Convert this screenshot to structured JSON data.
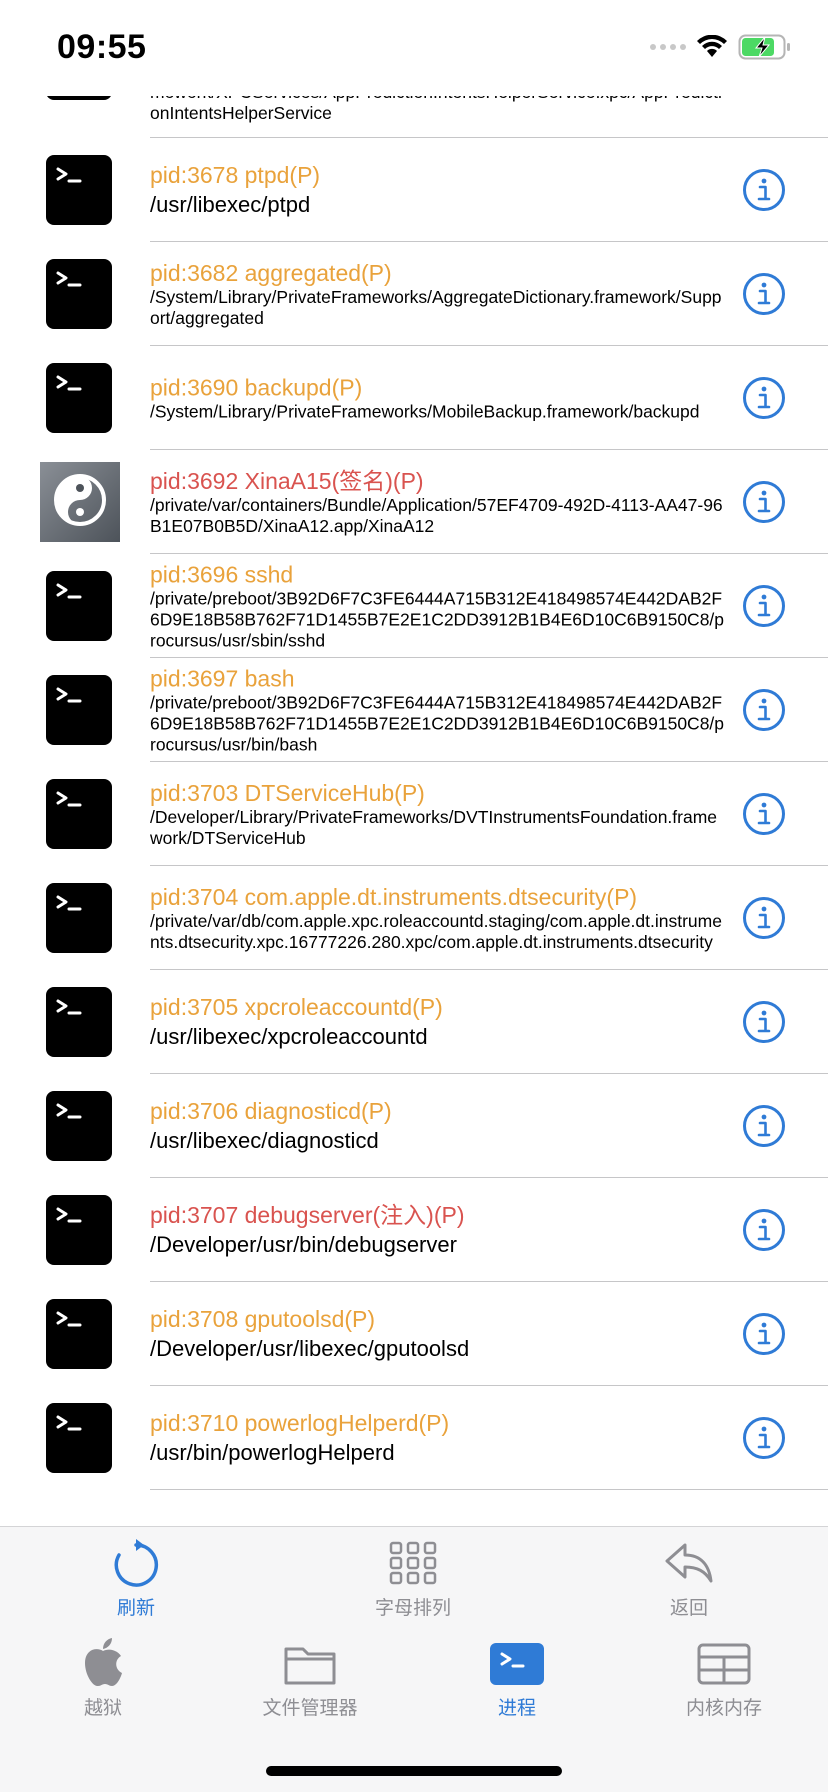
{
  "status_bar": {
    "time": "09:55"
  },
  "colors": {
    "orange": "#e9a23b",
    "red": "#d9534f",
    "blue": "#2f7bd6",
    "gray": "#8e8e93"
  },
  "partial_row": {
    "path": "mework/XPCServices/AppPredictionIntentsHelperService.xpc/AppPredictionIntentsHelperService"
  },
  "processes": [
    {
      "title": "pid:3678 ptpd(P)",
      "path": "/usr/libexec/ptpd",
      "style": "orange",
      "icon": "terminal-icon"
    },
    {
      "title": "pid:3682 aggregated(P)",
      "path": "/System/Library/PrivateFrameworks/AggregateDictionary.framework/Support/aggregated",
      "style": "orange",
      "icon": "terminal-icon"
    },
    {
      "title": "pid:3690 backupd(P)",
      "path": "/System/Library/PrivateFrameworks/MobileBackup.framework/backupd",
      "style": "orange",
      "icon": "terminal-icon"
    },
    {
      "title": "pid:3692 XinaA15(签名)(P)",
      "path": "/private/var/containers/Bundle/Application/57EF4709-492D-4113-AA47-96B1E07B0B5D/XinaA12.app/XinaA12",
      "style": "red",
      "icon": "xina-app-icon"
    },
    {
      "title": "pid:3696 sshd",
      "path": "/private/preboot/3B92D6F7C3FE6444A715B312E418498574E442DAB2F6D9E18B58B762F71D1455B7E2E1C2DD3912B1B4E6D10C6B9150C8/procursus/usr/sbin/sshd",
      "style": "orange",
      "icon": "terminal-icon"
    },
    {
      "title": "pid:3697 bash",
      "path": "/private/preboot/3B92D6F7C3FE6444A715B312E418498574E442DAB2F6D9E18B58B762F71D1455B7E2E1C2DD3912B1B4E6D10C6B9150C8/procursus/usr/bin/bash",
      "style": "orange",
      "icon": "terminal-icon"
    },
    {
      "title": "pid:3703 DTServiceHub(P)",
      "path": "/Developer/Library/PrivateFrameworks/DVTInstrumentsFoundation.framework/DTServiceHub",
      "style": "orange",
      "icon": "terminal-icon"
    },
    {
      "title": "pid:3704 com.apple.dt.instruments.dtsecurity(P)",
      "path": "/private/var/db/com.apple.xpc.roleaccountd.staging/com.apple.dt.instruments.dtsecurity.xpc.16777226.280.xpc/com.apple.dt.instruments.dtsecurity",
      "style": "orange",
      "icon": "terminal-icon"
    },
    {
      "title": "pid:3705 xpcroleaccountd(P)",
      "path": "/usr/libexec/xpcroleaccountd",
      "style": "orange",
      "icon": "terminal-icon"
    },
    {
      "title": "pid:3706 diagnosticd(P)",
      "path": "/usr/libexec/diagnosticd",
      "style": "orange",
      "icon": "terminal-icon"
    },
    {
      "title": "pid:3707 debugserver(注入)(P)",
      "path": "/Developer/usr/bin/debugserver",
      "style": "red",
      "icon": "terminal-icon"
    },
    {
      "title": "pid:3708 gputoolsd(P)",
      "path": "/Developer/usr/libexec/gputoolsd",
      "style": "orange",
      "icon": "terminal-icon"
    },
    {
      "title": "pid:3710 powerlogHelperd(P)",
      "path": "/usr/bin/powerlogHelperd",
      "style": "orange",
      "icon": "terminal-icon"
    }
  ],
  "toolbar": {
    "refresh": "刷新",
    "alphabetical": "字母排列",
    "back": "返回"
  },
  "tabs": {
    "jailbreak": "越狱",
    "file_manager": "文件管理器",
    "processes": "进程",
    "kernel_memory": "内核内存"
  }
}
